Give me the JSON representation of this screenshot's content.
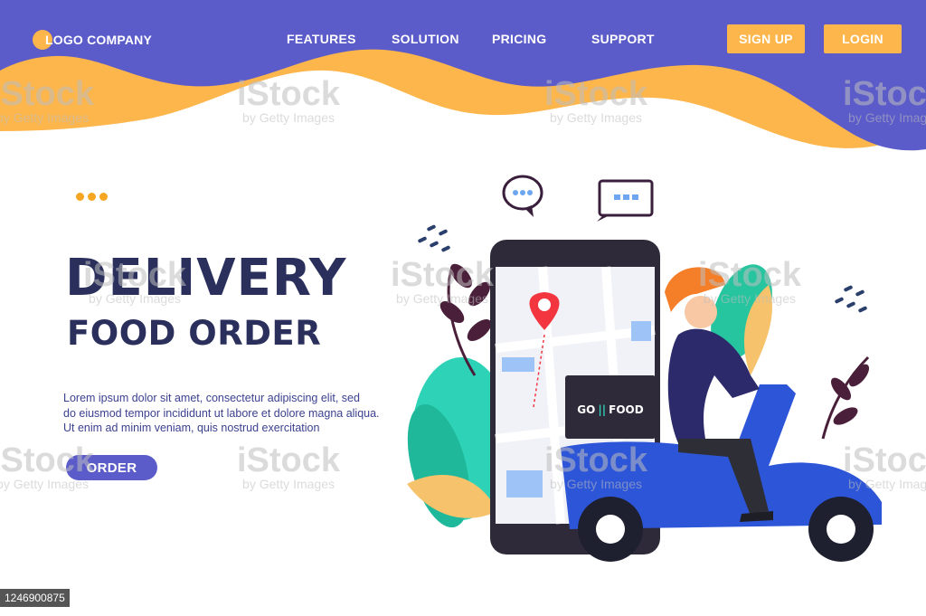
{
  "header": {
    "logo_text": "LOGO COMPANY",
    "nav": [
      {
        "label": "FEATURES"
      },
      {
        "label": "SOLUTION"
      },
      {
        "label": "PRICING"
      },
      {
        "label": "SUPPORT"
      }
    ],
    "signup_label": "SIGN UP",
    "login_label": "LOGIN"
  },
  "hero": {
    "title_line1": "DELIVERY",
    "title_line2": "FOOD ORDER",
    "body_lines": [
      "Lorem ipsum dolor sit amet, consectetur adipiscing elit, sed",
      "do eiusmod tempor incididunt ut labore et dolore magna aliqua.",
      "Ut enim ad minim veniam, quis nostrud exercitation"
    ],
    "order_label": "ORDER"
  },
  "illustration": {
    "box_label_1": "GO",
    "box_label_2": "FOOD"
  },
  "watermark": {
    "brand": "iStock",
    "by": "by Getty Images",
    "id": "1246900875"
  },
  "colors": {
    "header_purple": "#5B5BC9",
    "accent_orange": "#FDB64C",
    "title_navy": "#2A2F5B",
    "scooter_blue": "#2D55D8"
  }
}
